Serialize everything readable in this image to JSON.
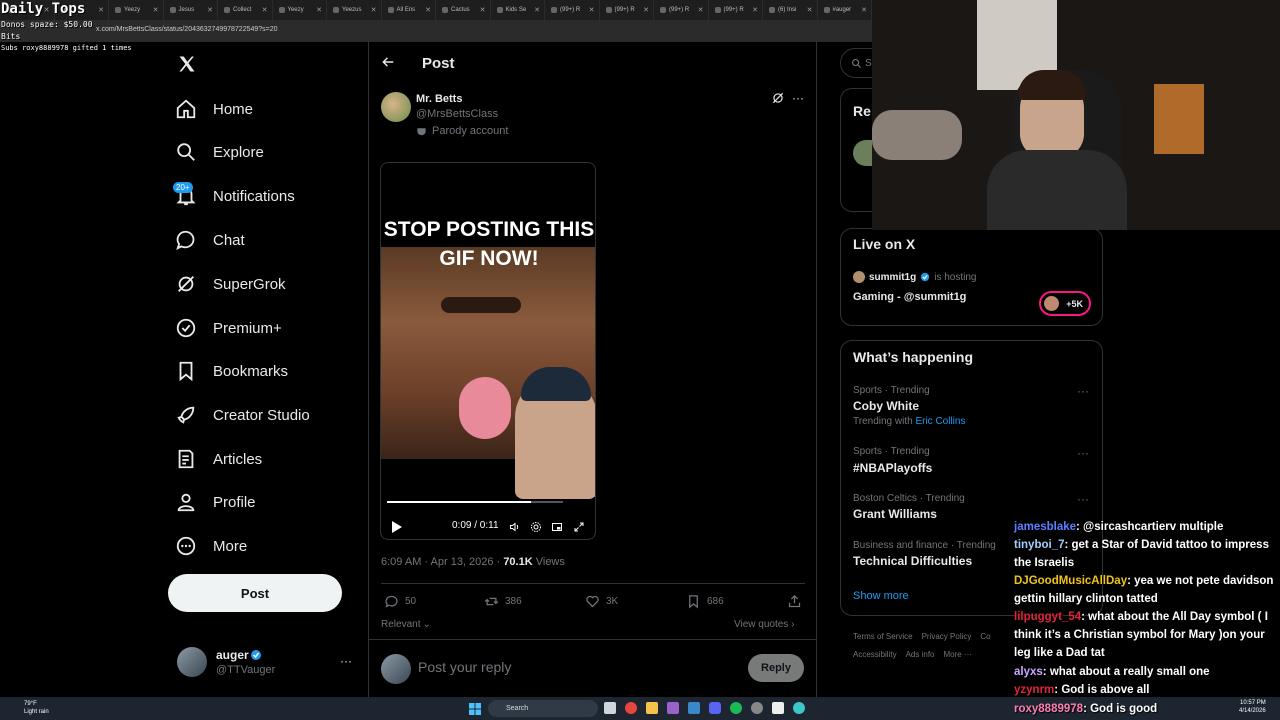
{
  "browser": {
    "tabs": [
      "",
      "",
      "Yeezy",
      "Jesus",
      "Collect",
      "Yeezy",
      "Yeezus",
      "All Ens",
      "Cactus",
      "Kids Se",
      "(99+) R",
      "(99+) R",
      "(99+) R",
      "(99+) R",
      "(6) Insi",
      "#auger"
    ],
    "url": "x.com/MrsBettsClass/status/2043632749978722549?s=20"
  },
  "stream_overlay": {
    "title": "Daily Tops",
    "donos": "Donos spaze: $50.00",
    "bits": "Bits",
    "subs": "Subs roxy8889978 gifted 1 times"
  },
  "nav": {
    "items": [
      "Home",
      "Explore",
      "Notifications",
      "Chat",
      "SuperGrok",
      "Premium+",
      "Bookmarks",
      "Creator Studio",
      "Articles",
      "Profile",
      "More"
    ],
    "notifications_badge": "20+",
    "post_button": "Post",
    "account": {
      "name": "auger",
      "handle": "@TTVauger"
    }
  },
  "post": {
    "header": "Post",
    "author_name": "Mr. Betts",
    "author_handle": "@MrsBettsClass",
    "parody_label": "Parody account",
    "gif_caption": "STOP POSTING THIS GIF NOW!",
    "video_time": "0:09 / 0:11",
    "video_progress": 0.82,
    "timestamp": "6:09 AM · Apr 13, 2026 ·",
    "views_count": "70.1K",
    "views_label": "Views",
    "replies": "50",
    "reposts": "386",
    "likes": "3K",
    "bookmarks": "686",
    "sort": "Relevant",
    "view_quotes": "View quotes",
    "reply_placeholder": "Post your reply",
    "reply_button": "Reply"
  },
  "right": {
    "search_partial": "S",
    "relevant_partial": "Re",
    "live_title": "Live on X",
    "live_host": "summit1g",
    "live_hosting": "is hosting",
    "live_space": "Gaming - @summit1g",
    "live_listeners": "+5K",
    "happening_title": "What’s happening",
    "trends": [
      {
        "meta": "Sports · Trending",
        "name": "Coby White",
        "with_label": "Trending with",
        "with_link": "Eric Collins"
      },
      {
        "meta": "Sports · Trending",
        "name": "#NBAPlayoffs"
      },
      {
        "meta": "Boston Celtics · Trending",
        "name": "Grant Williams"
      },
      {
        "meta": "Business and finance · Trending",
        "name": "Technical Difficulties"
      }
    ],
    "show_more": "Show more",
    "footer": [
      "Terms of Service",
      "Privacy Policy",
      "Co",
      "Accessibility",
      "Ads info",
      "More ···"
    ]
  },
  "chat": [
    {
      "user": "jamesblake",
      "color": "#5b7fff",
      "msg": "@sircashcartierv multiple"
    },
    {
      "user": "tinyboi_7",
      "color": "#9fd0ff",
      "msg": "get a Star of David tattoo to impress the Israelis"
    },
    {
      "user": "DJGoodMusicAllDay",
      "color": "#f0c419",
      "msg": "yea we not pete davidson gettin hillary clinton tatted"
    },
    {
      "user": "lilpuggyt_54",
      "color": "#e0243c",
      "msg": "what about the All Day symbol ( I think it’s a Christian symbol for Mary )on your leg like a Dad tat"
    },
    {
      "user": "alyxs",
      "color": "#c9a7ff",
      "msg": "what about a really small one"
    },
    {
      "user": "yzynrm",
      "color": "#e0243c",
      "msg": "God is above all"
    },
    {
      "user": "roxy8889978",
      "color": "#ff7eb3",
      "msg": "God is good"
    }
  ],
  "taskbar": {
    "weather_temp": "79°F",
    "weather_desc": "Light rain",
    "search": "Search",
    "time": "10:57 PM",
    "date": "4/14/2026"
  },
  "colors": {
    "accent": "#1d9bf0",
    "background": "#000000",
    "text": "#e7e9ea",
    "muted": "#71767b"
  }
}
